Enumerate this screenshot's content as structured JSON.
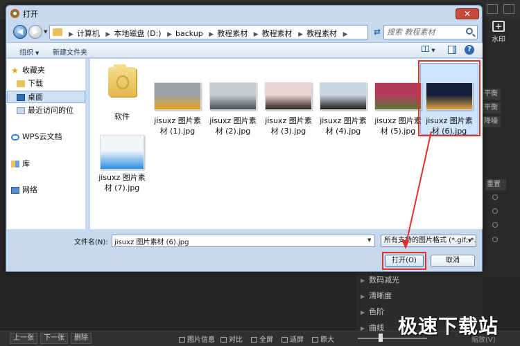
{
  "dialog": {
    "title": "打开",
    "close_label": "✕"
  },
  "address": {
    "crumbs": [
      "计算机",
      "本地磁盘 (D:)",
      "backup",
      "教程素材",
      "教程素材",
      "教程素材"
    ],
    "search_placeholder": "搜索 教程素材"
  },
  "toolbar": {
    "organize_label": "组织",
    "new_folder_label": "新建文件夹",
    "help_label": "?"
  },
  "nav_pane": {
    "items": [
      {
        "label": "收藏夹",
        "icon": "star-icon"
      },
      {
        "label": "下载",
        "icon": "download-folder-icon"
      },
      {
        "label": "桌面",
        "icon": "desktop-icon"
      },
      {
        "label": "最近访问的位",
        "icon": "recent-places-icon"
      },
      {
        "label": "WPS云文档",
        "icon": "cloud-icon"
      },
      {
        "label": "库",
        "icon": "library-icon"
      },
      {
        "label": "网络",
        "icon": "network-icon"
      }
    ]
  },
  "files": [
    {
      "name": "软件",
      "type": "folder"
    },
    {
      "name": "jisuxz 图片素材 (1).jpg",
      "type": "image",
      "thumb_colors": [
        "#9aa0a6",
        "#e8a21d"
      ]
    },
    {
      "name": "jisuxz 图片素材 (2).jpg",
      "type": "image",
      "thumb_colors": [
        "#c9cdd2",
        "#4a4f55"
      ]
    },
    {
      "name": "jisuxz 图片素材 (3).jpg",
      "type": "image",
      "thumb_colors": [
        "#e9d3cf",
        "#2a2220"
      ]
    },
    {
      "name": "jisuxz 图片素材 (4).jpg",
      "type": "image",
      "thumb_colors": [
        "#c8d6e2",
        "#1d1a1a"
      ]
    },
    {
      "name": "jisuxz 图片素材 (5).jpg",
      "type": "image",
      "thumb_colors": [
        "#b33a5a",
        "#5a7a3a"
      ]
    },
    {
      "name": "jisuxz 图片素材 (6).jpg",
      "type": "image",
      "thumb_colors": [
        "#14203a",
        "#e0a040"
      ],
      "selected": true
    },
    {
      "name": "jisuxz 图片素材 (7).jpg",
      "type": "image",
      "thumb_colors": [
        "#f2f6fb",
        "#2e8ee0"
      ]
    }
  ],
  "bottom": {
    "filename_label": "文件名(N):",
    "filename_value": "jisuxz 图片素材 (6).jpg",
    "filter_value": "所有支持的图片格式 (*.gif; *.til",
    "open_label": "打开(O)",
    "cancel_label": "取消"
  },
  "background_app": {
    "watermark_label": "水印",
    "side_buttons": [
      "平衡",
      "平衡",
      "降噪",
      "重置"
    ],
    "panel_rows": [
      "数码减光",
      "清晰度",
      "色阶",
      "曲线"
    ],
    "bottom_buttons": [
      "上一张",
      "下一张",
      "删除"
    ],
    "bottom_items": [
      "图片信息",
      "对比",
      "全屏",
      "适屏",
      "原大"
    ],
    "zoom_label": "缩放(V)",
    "site_logo": "极速下载站"
  },
  "colors": {
    "highlight_red": "#e03030",
    "selection_blue": "#cde4fb",
    "dialog_frame": "#c7d9ee"
  }
}
